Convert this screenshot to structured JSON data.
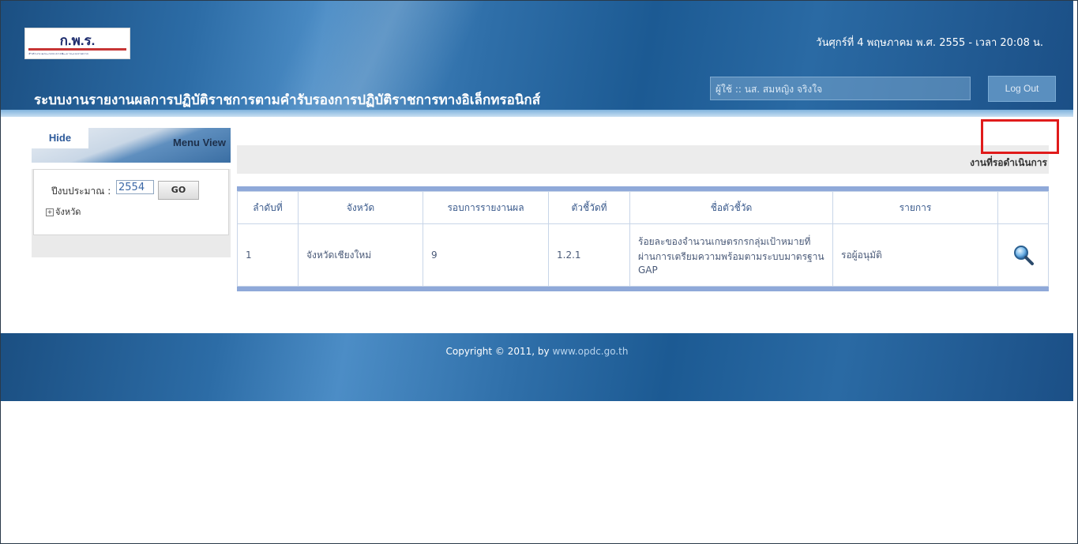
{
  "header": {
    "logo_text": "ก.พ.ร.",
    "logo_subtext": "สำนักงานคณะกรรมการพัฒนาระบบราชการ",
    "date_time": "วันศุกร์ที่ 4 พฤษภาคม พ.ศ. 2555 - เวลา 20:08 น.",
    "user_label": "ผู้ใช้ :: นส. สมหญิง จริงใจ",
    "logout_label": "Log Out",
    "system_title": "ระบบงานรายงานผลการปฏิบัติราชการตามคำรับรองการปฏิบัติราชการทางอิเล็กทรอนิกส์"
  },
  "sidebar": {
    "hide_label": "Hide",
    "menu_view_label": "Menu View",
    "year_label": "ปีงบประมาณ :",
    "year_value": "2554",
    "go_label": "GO",
    "tree_item": "จังหวัด"
  },
  "main": {
    "pending_title": "งานที่รอดำเนินการ",
    "columns": [
      "ลำดับที่",
      "จังหวัด",
      "รอบการรายงานผล",
      "ตัวชี้วัดที่",
      "ชื่อตัวชี้วัด",
      "รายการ",
      ""
    ],
    "rows": [
      {
        "order": "1",
        "province": "จังหวัดเชียงใหม่",
        "round": "9",
        "indicator_no": "1.2.1",
        "indicator_name": "ร้อยละของจำนวนเกษตรกรกลุ่มเป้าหมายที่ผ่านการเตรียมความพร้อมตามระบบมาตรฐาน GAP",
        "status": "รอผู้อนุมัติ",
        "action_icon": "search-icon"
      }
    ]
  },
  "footer": {
    "copyright_prefix": "Copyright © 2011, by",
    "url": "www.opdc.go.th"
  },
  "colors": {
    "header_blue": "#2c6ca6",
    "highlight_red": "#e01b1b",
    "table_border_blue": "#8fa9d9"
  }
}
